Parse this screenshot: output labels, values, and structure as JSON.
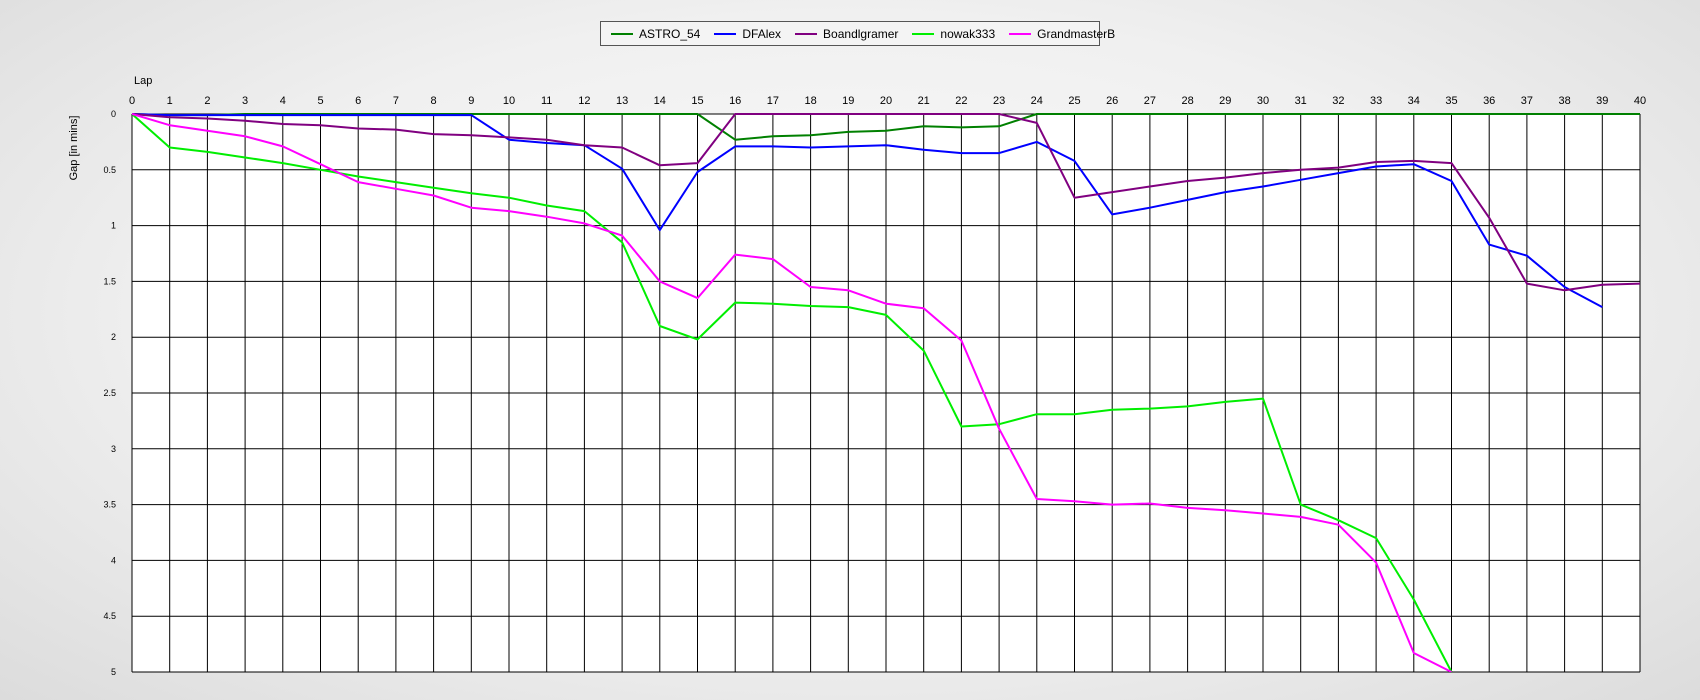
{
  "chart_data": {
    "type": "line",
    "xlabel": "Lap",
    "ylabel": "Gap [in mins]",
    "xlim": [
      0,
      40
    ],
    "ylim": [
      0,
      5
    ],
    "y_inverted": true,
    "grid": true,
    "legend_position": "top-center",
    "x_ticks": [
      0,
      1,
      2,
      3,
      4,
      5,
      6,
      7,
      8,
      9,
      10,
      11,
      12,
      13,
      14,
      15,
      16,
      17,
      18,
      19,
      20,
      21,
      22,
      23,
      24,
      25,
      26,
      27,
      28,
      29,
      30,
      31,
      32,
      33,
      34,
      35,
      36,
      37,
      38,
      39,
      40
    ],
    "y_ticks": [
      "0",
      "0.5",
      "1",
      "1.5",
      "2",
      "2.5",
      "3",
      "3.5",
      "4",
      "4.5",
      "5"
    ],
    "series": [
      {
        "name": "ASTRO_54",
        "color": "#008000",
        "x": [
          0,
          1,
          2,
          3,
          4,
          5,
          6,
          7,
          8,
          9,
          10,
          11,
          12,
          13,
          14,
          15,
          16,
          17,
          18,
          19,
          20,
          21,
          22,
          23,
          24,
          25,
          26,
          27,
          28,
          29,
          30,
          31,
          32,
          33,
          34,
          35,
          36,
          37,
          38,
          39,
          40
        ],
        "y": [
          0,
          0.01,
          0.01,
          0,
          0,
          0,
          0,
          0,
          0,
          0,
          0,
          0,
          0,
          0,
          0,
          0,
          0.23,
          0.2,
          0.19,
          0.16,
          0.15,
          0.11,
          0.12,
          0.11,
          0,
          0,
          0,
          0,
          0,
          0,
          0,
          0,
          0,
          0,
          0,
          0,
          0,
          0,
          0,
          0,
          0
        ]
      },
      {
        "name": "DFAlex",
        "color": "#0000FF",
        "x": [
          0,
          1,
          2,
          3,
          4,
          5,
          6,
          7,
          8,
          9,
          10,
          11,
          12,
          13,
          14,
          15,
          16,
          17,
          18,
          19,
          20,
          21,
          22,
          23,
          24,
          25,
          26,
          27,
          28,
          29,
          30,
          31,
          32,
          33,
          34,
          35,
          36,
          37,
          38,
          39
        ],
        "y": [
          0,
          0.01,
          0.01,
          0.01,
          0.01,
          0.01,
          0.01,
          0.01,
          0.01,
          0.01,
          0.23,
          0.26,
          0.28,
          0.49,
          1.04,
          0.52,
          0.29,
          0.29,
          0.3,
          0.29,
          0.28,
          0.32,
          0.35,
          0.35,
          0.25,
          0.42,
          0.9,
          0.84,
          0.77,
          0.7,
          0.65,
          0.59,
          0.53,
          0.47,
          0.45,
          0.6,
          1.17,
          1.27,
          1.55,
          1.73
        ]
      },
      {
        "name": "Boandlgramer",
        "color": "#800080",
        "x": [
          0,
          1,
          2,
          3,
          4,
          5,
          6,
          7,
          8,
          9,
          10,
          11,
          12,
          13,
          14,
          15,
          16,
          17,
          18,
          19,
          20,
          21,
          22,
          23,
          24,
          25,
          26,
          27,
          28,
          29,
          30,
          31,
          32,
          33,
          34,
          35,
          36,
          37,
          38,
          39,
          40
        ],
        "y": [
          0,
          0.03,
          0.04,
          0.06,
          0.09,
          0.1,
          0.13,
          0.14,
          0.18,
          0.19,
          0.21,
          0.23,
          0.28,
          0.3,
          0.46,
          0.44,
          0,
          0,
          0,
          0,
          0,
          0,
          0,
          0,
          0.08,
          0.75,
          0.7,
          0.65,
          0.6,
          0.57,
          0.53,
          0.5,
          0.48,
          0.43,
          0.42,
          0.44,
          0.93,
          1.52,
          1.58,
          1.53,
          1.52
        ]
      },
      {
        "name": "nowak333",
        "color": "#00EE00",
        "x": [
          0,
          1,
          2,
          3,
          4,
          5,
          6,
          7,
          8,
          9,
          10,
          11,
          12,
          13,
          14,
          15,
          16,
          17,
          18,
          19,
          20,
          21,
          22,
          23,
          24,
          25,
          26,
          27,
          28,
          29,
          30,
          31,
          32,
          33,
          34,
          35
        ],
        "y": [
          0,
          0.3,
          0.34,
          0.39,
          0.44,
          0.5,
          0.56,
          0.61,
          0.66,
          0.71,
          0.75,
          0.82,
          0.87,
          1.15,
          1.9,
          2.02,
          1.69,
          1.7,
          1.72,
          1.73,
          1.8,
          2.12,
          2.8,
          2.78,
          2.69,
          2.69,
          2.65,
          2.64,
          2.62,
          2.58,
          2.55,
          3.5,
          3.64,
          3.8,
          4.35,
          5.0
        ]
      },
      {
        "name": "GrandmasterB",
        "color": "#FF00FF",
        "x": [
          0,
          1,
          2,
          3,
          4,
          5,
          6,
          7,
          8,
          9,
          10,
          11,
          12,
          13,
          14,
          15,
          16,
          17,
          18,
          19,
          20,
          21,
          22,
          23,
          24,
          25,
          26,
          27,
          28,
          29,
          30,
          31,
          32,
          33,
          34,
          35
        ],
        "y": [
          0,
          0.1,
          0.15,
          0.2,
          0.29,
          0.45,
          0.61,
          0.67,
          0.73,
          0.84,
          0.87,
          0.92,
          0.98,
          1.09,
          1.5,
          1.65,
          1.26,
          1.3,
          1.55,
          1.58,
          1.7,
          1.74,
          2.03,
          2.82,
          3.45,
          3.47,
          3.5,
          3.49,
          3.53,
          3.55,
          3.58,
          3.61,
          3.68,
          4.02,
          4.83,
          5.0
        ]
      }
    ]
  }
}
